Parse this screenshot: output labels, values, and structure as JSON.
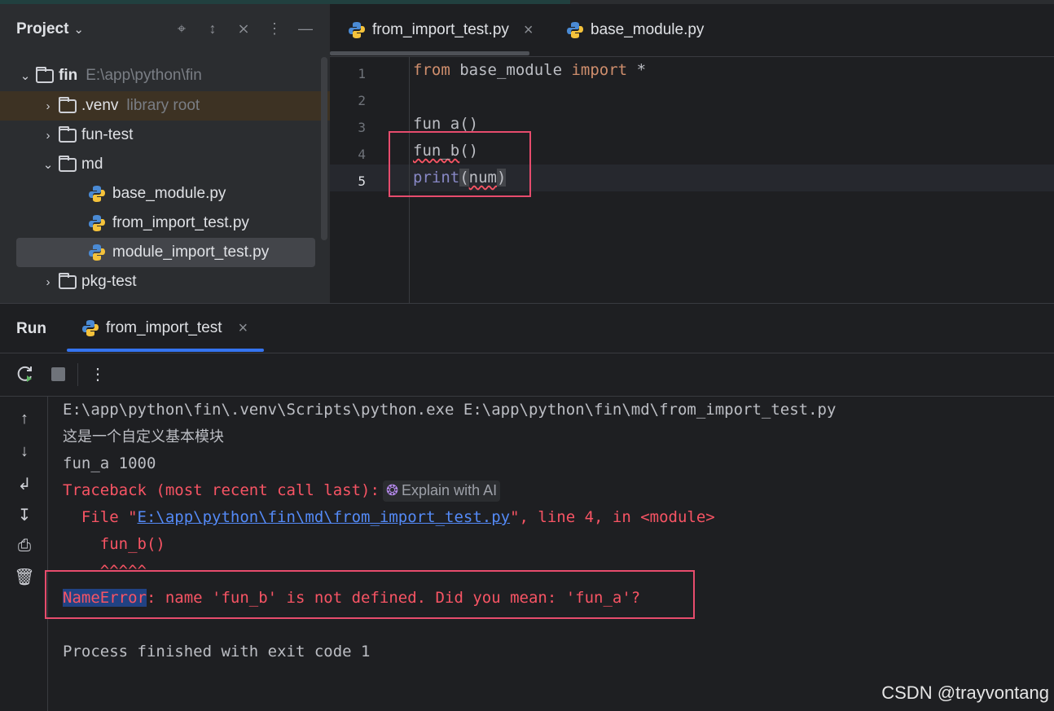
{
  "project": {
    "title": "Project",
    "tree": [
      {
        "name": "fin",
        "hint": "E:\\app\\python\\fin"
      },
      {
        "name": ".venv",
        "hint": "library root"
      },
      {
        "name": "fun-test"
      },
      {
        "name": "md"
      },
      {
        "name": "base_module.py"
      },
      {
        "name": "from_import_test.py"
      },
      {
        "name": "module_import_test.py"
      },
      {
        "name": "pkg-test"
      }
    ]
  },
  "editor": {
    "tabs": [
      {
        "label": "from_import_test.py"
      },
      {
        "label": "base_module.py"
      }
    ],
    "line_numbers": [
      "1",
      "2",
      "3",
      "4",
      "5"
    ],
    "code": {
      "l1_kw1": "from",
      "l1_mod": " base_module ",
      "l1_kw2": "import",
      "l1_rest": " *",
      "l3": "fun_a()",
      "l4_name": "fun_b",
      "l4_rest": "()",
      "l5_fn": "print",
      "l5_open": "(",
      "l5_arg": "num",
      "l5_close": ")"
    }
  },
  "run": {
    "title": "Run",
    "tab_label": "from_import_test",
    "console": {
      "line1": "E:\\app\\python\\fin\\.venv\\Scripts\\python.exe E:\\app\\python\\fin\\md\\from_import_test.py",
      "line2": "这是一个自定义基本模块",
      "line3": "fun_a 1000",
      "line4": "Traceback (most recent call last):",
      "ai_label": "Explain with AI",
      "line5_pre": "  File \"",
      "line5_link": "E:\\app\\python\\fin\\md\\from_import_test.py",
      "line5_post": "\", line 4, in <module>",
      "line6": "    fun_b()",
      "line7": "    ^^^^^",
      "line8_sel": "NameError",
      "line8_rest": ": name 'fun_b' is not defined. Did you mean: 'fun_a'?",
      "line9": "Process finished with exit code 1"
    }
  },
  "watermark": "CSDN @trayvontang",
  "colors": {
    "keyword": "#cf8e6d",
    "builtin": "#8888c6",
    "error": "#f75464",
    "link": "#548af7",
    "highlight_box": "#e74c6d",
    "tab_accent": "#3574f0"
  }
}
